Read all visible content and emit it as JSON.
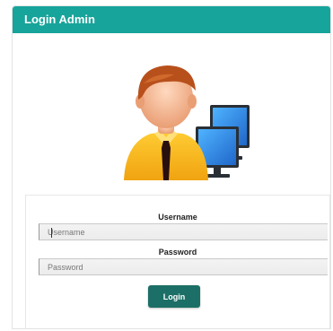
{
  "panel": {
    "title": "Login Admin"
  },
  "form": {
    "username": {
      "label": "Username",
      "placeholder": "Username",
      "value": ""
    },
    "password": {
      "label": "Password",
      "placeholder": "Password",
      "value": ""
    },
    "submit_label": "Login"
  },
  "colors": {
    "header": "#17a49a",
    "button": "#1c6f66"
  },
  "icons": {
    "avatar": "admin-user-computer-icon"
  }
}
